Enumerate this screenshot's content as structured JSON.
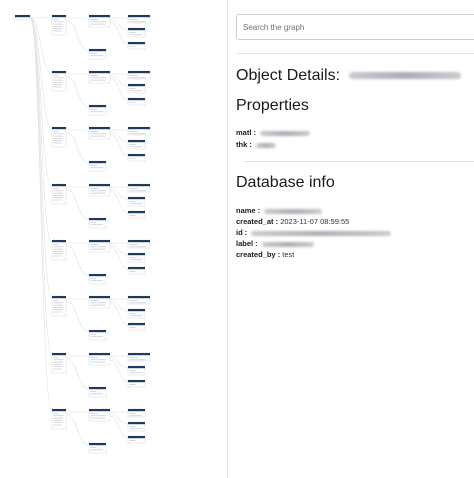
{
  "search": {
    "placeholder": "Search the graph"
  },
  "details": {
    "title": "Object Details:",
    "properties_heading": "Properties",
    "properties": [
      {
        "key": "matl :",
        "value": ""
      },
      {
        "key": "thk :",
        "value": ""
      }
    ],
    "database_heading": "Database info",
    "database": [
      {
        "key": "name :",
        "value": ""
      },
      {
        "key": "created_at :",
        "value": "2023-11-07 08:59:55"
      },
      {
        "key": "id :",
        "value": ""
      },
      {
        "key": "label :",
        "value": ""
      },
      {
        "key": "created_by :",
        "value": "test"
      }
    ]
  },
  "colors": {
    "node_header": "#1f3b5c",
    "edge": "#dde2e6",
    "border": "#c9cdd2"
  },
  "icons": {
    "redacted": "blurred-text"
  }
}
